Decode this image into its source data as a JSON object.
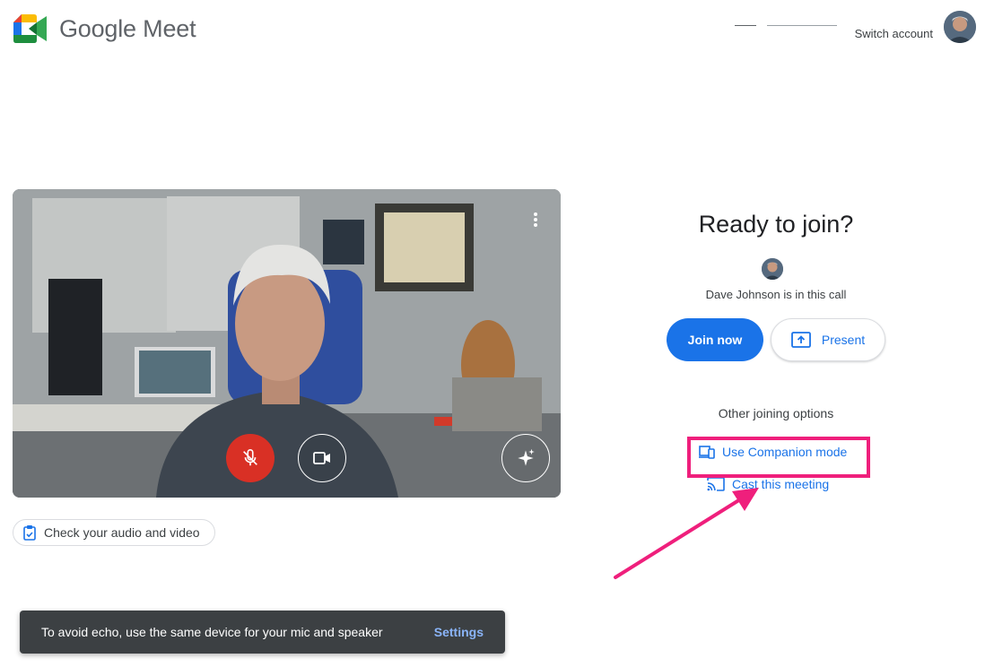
{
  "header": {
    "product_name": "Google Meet",
    "switch_account_label": "Switch account"
  },
  "preview": {
    "check_audio_video_label": "Check your audio and video",
    "mic_muted": true,
    "camera_on": true
  },
  "join_panel": {
    "title": "Ready to join?",
    "participants_text": "Dave Johnson is in this call",
    "join_button_label": "Join now",
    "present_button_label": "Present",
    "other_options_heading": "Other joining options",
    "companion_mode_label": "Use Companion mode",
    "cast_label": "Cast this meeting"
  },
  "snackbar": {
    "message": "To avoid echo, use the same device for your mic and speaker",
    "action_label": "Settings"
  },
  "colors": {
    "primary_blue": "#1a73e8",
    "mic_off_red": "#d93025",
    "annotation_pink": "#ef1f7c",
    "snackbar_bg": "#3c4043"
  },
  "icons": {
    "logo": "google-meet-logo",
    "mic": "mic-off-icon",
    "camera": "videocam-icon",
    "effects": "sparkle-icon",
    "present": "present-to-all-icon",
    "companion": "devices-icon",
    "cast": "cast-icon",
    "check": "clipboard-check-icon"
  }
}
